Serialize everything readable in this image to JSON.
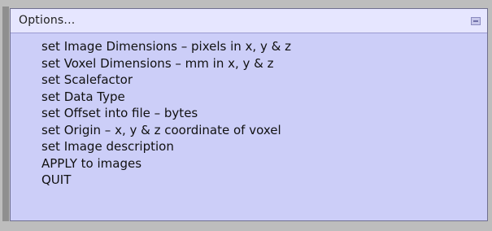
{
  "menu": {
    "title": "Options...",
    "items": [
      "set Image Dimensions – pixels in x, y & z",
      "set Voxel Dimensions – mm in x, y & z",
      "set Scalefactor",
      "set Data Type",
      "set Offset into file – bytes",
      "set Origin – x, y & z coordinate of voxel",
      "set Image description",
      "APPLY to images",
      "QUIT"
    ]
  },
  "colors": {
    "menu_background": "#cccef8",
    "title_background": "#e6e6ff",
    "window_background": "#bdbdbd"
  }
}
